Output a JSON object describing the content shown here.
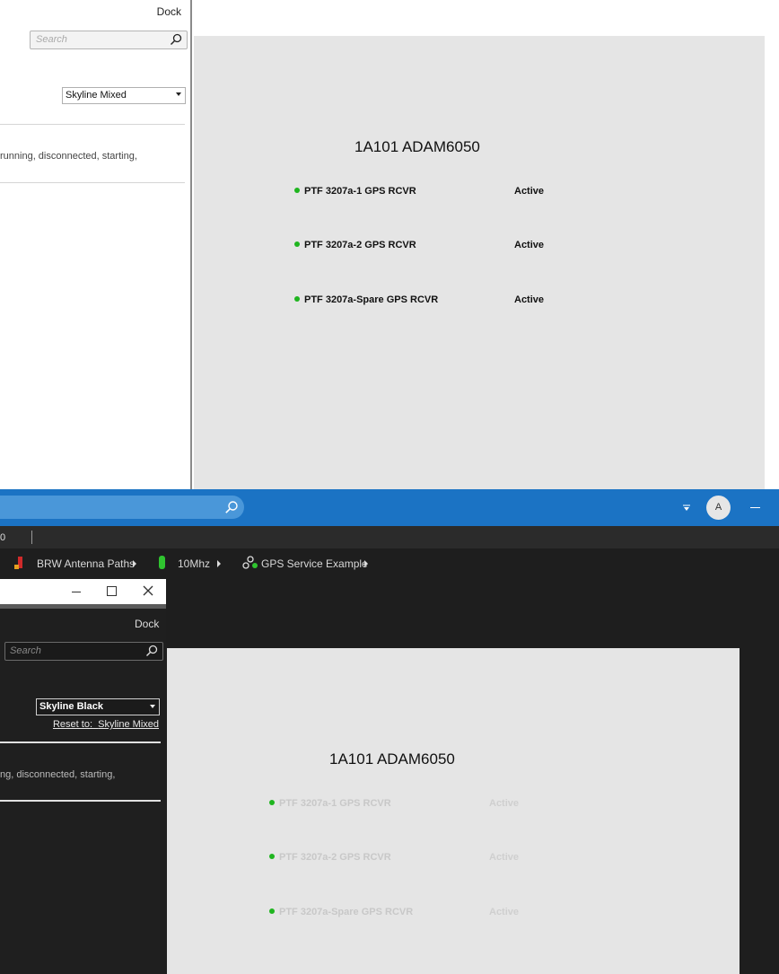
{
  "top_panel": {
    "dock_label": "Dock",
    "search_placeholder": "Search",
    "theme_selected": "Skyline Mixed",
    "states_text": "running, disconnected, starting,"
  },
  "top_canvas": {
    "title": "1A101 ADAM6050",
    "rows": [
      {
        "name": "PTF 3207a-1 GPS RCVR",
        "status": "Active"
      },
      {
        "name": "PTF 3207a-2 GPS RCVR",
        "status": "Active"
      },
      {
        "name": "PTF 3207a-Spare GPS RCVR",
        "status": "Active"
      }
    ]
  },
  "titlebar": {
    "avatar_initial": "A"
  },
  "strip": {
    "text": "0"
  },
  "bookmarks": [
    {
      "label": "BRW Antenna Paths"
    },
    {
      "label": "10Mhz"
    },
    {
      "label": "GPS Service Example"
    }
  ],
  "bottom_panel": {
    "dock_label": "Dock",
    "search_placeholder": "Search",
    "theme_selected": "Skyline Black",
    "reset_prefix": "Reset to:",
    "reset_value": "Skyline Mixed",
    "states_text": "ng, disconnected, starting,"
  },
  "bottom_canvas": {
    "title": "1A101 ADAM6050",
    "rows": [
      {
        "name": "PTF 3207a-1 GPS RCVR",
        "status": "Active"
      },
      {
        "name": "PTF 3207a-2 GPS RCVR",
        "status": "Active"
      },
      {
        "name": "PTF 3207a-Spare GPS RCVR",
        "status": "Active"
      }
    ]
  },
  "colors": {
    "status_dot": "#1fb51f",
    "titlebar": "#1b73c4",
    "dark_bg": "#1e1e1e",
    "canvas_bg": "#e5e5e5"
  }
}
